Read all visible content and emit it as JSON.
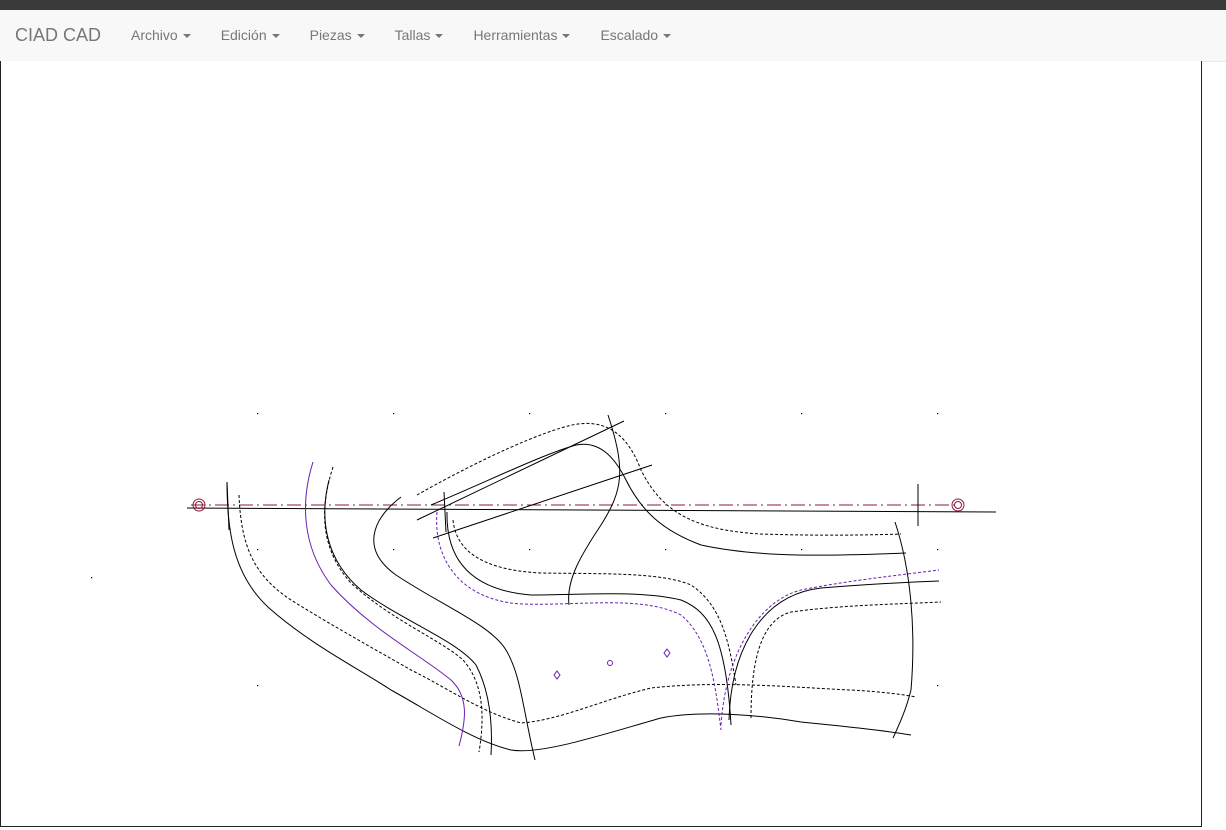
{
  "app": {
    "brand": "CIAD CAD"
  },
  "menu": [
    {
      "label": "Archivo"
    },
    {
      "label": "Edición"
    },
    {
      "label": "Piezas"
    },
    {
      "label": "Tallas"
    },
    {
      "label": "Herramientas"
    },
    {
      "label": "Escalado"
    }
  ],
  "icons": {
    "menu_dropdown": "caret-down-icon"
  },
  "colors": {
    "navbar_bg": "#f8f8f8",
    "line": "#000000",
    "accent_purple": "#6a1fb0",
    "axis_red": "#8a1a3a"
  }
}
